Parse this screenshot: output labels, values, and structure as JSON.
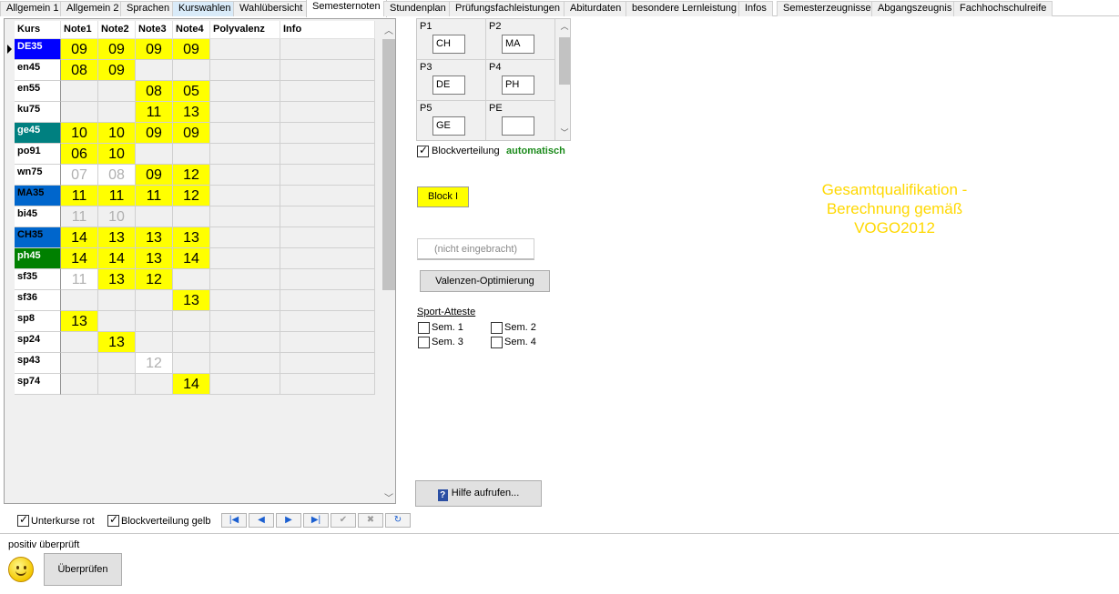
{
  "tabs": [
    {
      "label": "Allgemein 1"
    },
    {
      "label": "Allgemein 2"
    },
    {
      "label": "Sprachen"
    },
    {
      "label": "Kurswahlen"
    },
    {
      "label": "Wahlübersicht"
    },
    {
      "label": "Semesternoten"
    },
    {
      "label": "Stundenplan"
    },
    {
      "label": "Prüfungsfachleistungen"
    },
    {
      "label": "Abiturdaten"
    },
    {
      "label": "besondere Lernleistung"
    },
    {
      "label": "Infos"
    },
    {
      "label": "Semesterzeugnisse"
    },
    {
      "label": "Abgangszeugnis"
    },
    {
      "label": "Fachhochschulreife"
    }
  ],
  "active_tab": "Semesternoten",
  "grid": {
    "headers": [
      "Kurs",
      "Note1",
      "Note2",
      "Note3",
      "Note4",
      "Polyvalenz",
      "Info"
    ],
    "rows": [
      {
        "kurs": "DE35",
        "kurs_bg": "#0000ff",
        "kurs_color": "#ffffff",
        "grades": [
          {
            "v": "09",
            "s": "y"
          },
          {
            "v": "09",
            "s": "y"
          },
          {
            "v": "09",
            "s": "y"
          },
          {
            "v": "09",
            "s": "y"
          }
        ]
      },
      {
        "kurs": "en45",
        "kurs_bg": "#ffffff",
        "kurs_color": "#000000",
        "grades": [
          {
            "v": "08",
            "s": "y"
          },
          {
            "v": "09",
            "s": "y"
          },
          {
            "v": "",
            "s": "e"
          },
          {
            "v": "",
            "s": "e"
          }
        ]
      },
      {
        "kurs": "en55",
        "kurs_bg": "#ffffff",
        "kurs_color": "#000000",
        "grades": [
          {
            "v": "",
            "s": "e"
          },
          {
            "v": "",
            "s": "e"
          },
          {
            "v": "08",
            "s": "y"
          },
          {
            "v": "05",
            "s": "y"
          }
        ]
      },
      {
        "kurs": "ku75",
        "kurs_bg": "#ffffff",
        "kurs_color": "#000000",
        "grades": [
          {
            "v": "",
            "s": "e"
          },
          {
            "v": "",
            "s": "e"
          },
          {
            "v": "11",
            "s": "y"
          },
          {
            "v": "13",
            "s": "y"
          }
        ]
      },
      {
        "kurs": "ge45",
        "kurs_bg": "#008080",
        "kurs_color": "#ffffff",
        "grades": [
          {
            "v": "10",
            "s": "y"
          },
          {
            "v": "10",
            "s": "y"
          },
          {
            "v": "09",
            "s": "y"
          },
          {
            "v": "09",
            "s": "y"
          }
        ]
      },
      {
        "kurs": "po91",
        "kurs_bg": "#ffffff",
        "kurs_color": "#000000",
        "grades": [
          {
            "v": "06",
            "s": "y"
          },
          {
            "v": "10",
            "s": "y"
          },
          {
            "v": "",
            "s": "e"
          },
          {
            "v": "",
            "s": "e"
          }
        ]
      },
      {
        "kurs": "wn75",
        "kurs_bg": "#ffffff",
        "kurs_color": "#000000",
        "grades": [
          {
            "v": "07",
            "s": "g"
          },
          {
            "v": "08",
            "s": "g"
          },
          {
            "v": "09",
            "s": "y"
          },
          {
            "v": "12",
            "s": "y"
          }
        ]
      },
      {
        "kurs": "MA35",
        "kurs_bg": "#0066cc",
        "kurs_color": "#000000",
        "grades": [
          {
            "v": "11",
            "s": "y"
          },
          {
            "v": "11",
            "s": "y"
          },
          {
            "v": "11",
            "s": "y"
          },
          {
            "v": "12",
            "s": "y"
          }
        ]
      },
      {
        "kurs": "bi45",
        "kurs_bg": "#ffffff",
        "kurs_color": "#000000",
        "grades": [
          {
            "v": "11",
            "s": "ge"
          },
          {
            "v": "10",
            "s": "ge"
          },
          {
            "v": "",
            "s": "e"
          },
          {
            "v": "",
            "s": "e"
          }
        ]
      },
      {
        "kurs": "CH35",
        "kurs_bg": "#0066cc",
        "kurs_color": "#000000",
        "grades": [
          {
            "v": "14",
            "s": "y"
          },
          {
            "v": "13",
            "s": "y"
          },
          {
            "v": "13",
            "s": "y"
          },
          {
            "v": "13",
            "s": "y"
          }
        ]
      },
      {
        "kurs": "ph45",
        "kurs_bg": "#008000",
        "kurs_color": "#ffffff",
        "grades": [
          {
            "v": "14",
            "s": "y"
          },
          {
            "v": "14",
            "s": "y"
          },
          {
            "v": "13",
            "s": "y"
          },
          {
            "v": "14",
            "s": "y"
          }
        ]
      },
      {
        "kurs": "sf35",
        "kurs_bg": "#ffffff",
        "kurs_color": "#000000",
        "grades": [
          {
            "v": "11",
            "s": "g"
          },
          {
            "v": "13",
            "s": "y"
          },
          {
            "v": "12",
            "s": "y"
          },
          {
            "v": "",
            "s": "e"
          }
        ]
      },
      {
        "kurs": "sf36",
        "kurs_bg": "#ffffff",
        "kurs_color": "#000000",
        "grades": [
          {
            "v": "",
            "s": "e"
          },
          {
            "v": "",
            "s": "e"
          },
          {
            "v": "",
            "s": "e"
          },
          {
            "v": "13",
            "s": "y"
          }
        ]
      },
      {
        "kurs": "sp8",
        "kurs_bg": "#ffffff",
        "kurs_color": "#000000",
        "grades": [
          {
            "v": "13",
            "s": "y"
          },
          {
            "v": "",
            "s": "e"
          },
          {
            "v": "",
            "s": "e"
          },
          {
            "v": "",
            "s": "e"
          }
        ]
      },
      {
        "kurs": "sp24",
        "kurs_bg": "#ffffff",
        "kurs_color": "#000000",
        "grades": [
          {
            "v": "",
            "s": "e"
          },
          {
            "v": "13",
            "s": "y"
          },
          {
            "v": "",
            "s": "e"
          },
          {
            "v": "",
            "s": "e"
          }
        ]
      },
      {
        "kurs": "sp43",
        "kurs_bg": "#ffffff",
        "kurs_color": "#000000",
        "grades": [
          {
            "v": "",
            "s": "e"
          },
          {
            "v": "",
            "s": "e"
          },
          {
            "v": "12",
            "s": "g"
          },
          {
            "v": "",
            "s": "e"
          }
        ]
      },
      {
        "kurs": "sp74",
        "kurs_bg": "#ffffff",
        "kurs_color": "#000000",
        "grades": [
          {
            "v": "",
            "s": "e"
          },
          {
            "v": "",
            "s": "e"
          },
          {
            "v": "",
            "s": "e"
          },
          {
            "v": "14",
            "s": "y"
          }
        ]
      }
    ]
  },
  "pruefung": {
    "items": [
      {
        "label": "P1",
        "value": "CH"
      },
      {
        "label": "P2",
        "value": "MA"
      },
      {
        "label": "P3",
        "value": "DE"
      },
      {
        "label": "P4",
        "value": "PH"
      },
      {
        "label": "P5",
        "value": "GE"
      },
      {
        "label": "PE",
        "value": ""
      }
    ]
  },
  "blockverteilung": {
    "label": "Blockverteilung",
    "checked": true,
    "status": "automatisch"
  },
  "block_button": "Block I",
  "nicht_button": "(nicht eingebracht)",
  "valenz_button": "Valenzen-Optimierung",
  "gesamt": {
    "line1": "Gesamtqualifikation -",
    "line2": "Berechnung gemäß",
    "line3": "VOGO2012"
  },
  "sport": {
    "title": "Sport-Atteste",
    "items": [
      {
        "label": "Sem. 1",
        "checked": false
      },
      {
        "label": "Sem. 2",
        "checked": false
      },
      {
        "label": "Sem. 3",
        "checked": false
      },
      {
        "label": "Sem. 4",
        "checked": false
      }
    ]
  },
  "hilfe_button": "Hilfe aufrufen...",
  "options": {
    "unterkurse": {
      "label": "Unterkurse rot",
      "checked": true
    },
    "blockgelb": {
      "label": "Blockverteilung gelb",
      "checked": true
    }
  },
  "nav": {
    "first": "|◀",
    "prev": "◀",
    "next": "▶",
    "last": "▶|",
    "confirm": "✔",
    "cancel": "✖",
    "refresh": "↻"
  },
  "status": {
    "text": "positiv überprüft"
  },
  "check_button": "Überprüfen",
  "colors": {
    "yellow": "#ffff00",
    "grey_text": "#b0b0b0",
    "accent_green": "#1a8a1a",
    "gold_text": "#ffd800"
  }
}
